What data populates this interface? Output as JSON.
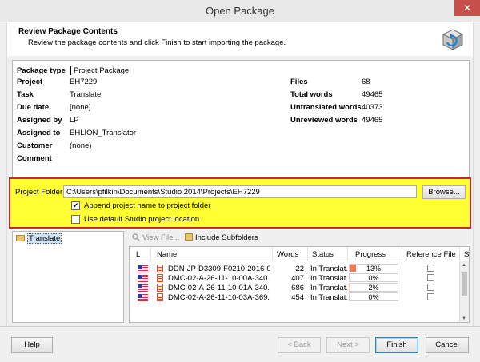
{
  "window": {
    "title": "Open Package",
    "close_glyph": "✕"
  },
  "header": {
    "title": "Review Package Contents",
    "subtitle": "Review the package contents and click Finish to start importing the package.",
    "icon": "package-cube-icon"
  },
  "info": {
    "package_type_label": "Package type",
    "package_type_value": "Project Package",
    "project_label": "Project",
    "project_value": "EH7229",
    "task_label": "Task",
    "task_value": "Translate",
    "due_date_label": "Due date",
    "due_date_value": "[none]",
    "assigned_by_label": "Assigned by",
    "assigned_by_value": "LP",
    "assigned_to_label": "Assigned to",
    "assigned_to_value": "EHLION_Translator",
    "customer_label": "Customer",
    "customer_value": "(none)",
    "comment_label": "Comment",
    "stats": {
      "files_label": "Files",
      "files_value": "68",
      "total_words_label": "Total words",
      "total_words_value": "49465",
      "untranslated_label": "Untranslated words",
      "untranslated_value": "40373",
      "unreviewed_label": "Unreviewed words",
      "unreviewed_value": "49465"
    }
  },
  "folder": {
    "label": "Project Folder:",
    "path": "C:\\Users\\pfilkin\\Documents\\Studio 2014\\Projects\\EH7229",
    "browse_label": "Browse...",
    "append_label": "Append project name to project folder",
    "append_checked": true,
    "default_label": "Use default Studio project location",
    "default_checked": false,
    "highlight_color": "#ffff33",
    "border_color": "#cc2a2a"
  },
  "tree": {
    "node_label": "Translate"
  },
  "toolbar": {
    "view_file_label": "View File...",
    "include_subfolders_label": "Include Subfolders"
  },
  "grid": {
    "columns": [
      "L",
      "Name",
      "Words",
      "Status",
      "Progress",
      "Reference File",
      "S"
    ],
    "rows": [
      {
        "name": "DDN-JP-D3309-F0210-2016-0...",
        "words": "22",
        "status": "In Translat...",
        "progress_text": "13%",
        "progress": 0.13
      },
      {
        "name": "DMC-02-A-26-11-10-00A-340...",
        "words": "407",
        "status": "In Translat...",
        "progress_text": "0%",
        "progress": 0
      },
      {
        "name": "DMC-02-A-26-11-10-01A-340...",
        "words": "686",
        "status": "In Translat...",
        "progress_text": "2%",
        "progress": 0.02
      },
      {
        "name": "DMC-02-A-26-11-10-03A-369...",
        "words": "454",
        "status": "In Translat...",
        "progress_text": "0%",
        "progress": 0
      }
    ],
    "progress_color": "#f27a52"
  },
  "footer": {
    "help_label": "Help",
    "back_label": "< Back",
    "next_label": "Next >",
    "finish_label": "Finish",
    "cancel_label": "Cancel"
  }
}
